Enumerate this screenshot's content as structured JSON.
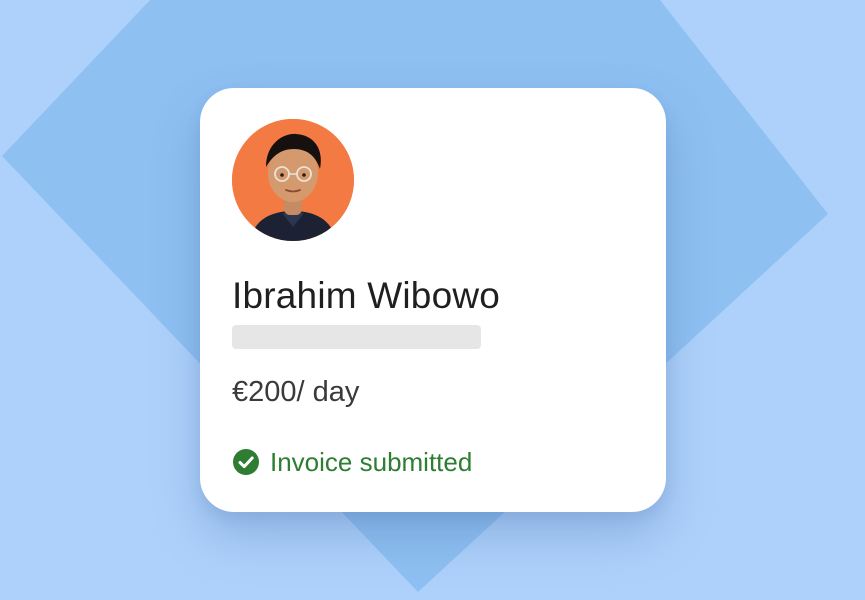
{
  "profile": {
    "name": "Ibrahim Wibowo",
    "rate": "€200/ day",
    "avatar_icon": "person-portrait-icon",
    "avatar_bg_color": "#f47a43"
  },
  "status": {
    "icon": "check-circle-icon",
    "label": "Invoice submitted",
    "color": "#2e7d32"
  },
  "colors": {
    "background": "#aed1fb",
    "diamond": "#8fc0f2",
    "card": "#ffffff"
  }
}
